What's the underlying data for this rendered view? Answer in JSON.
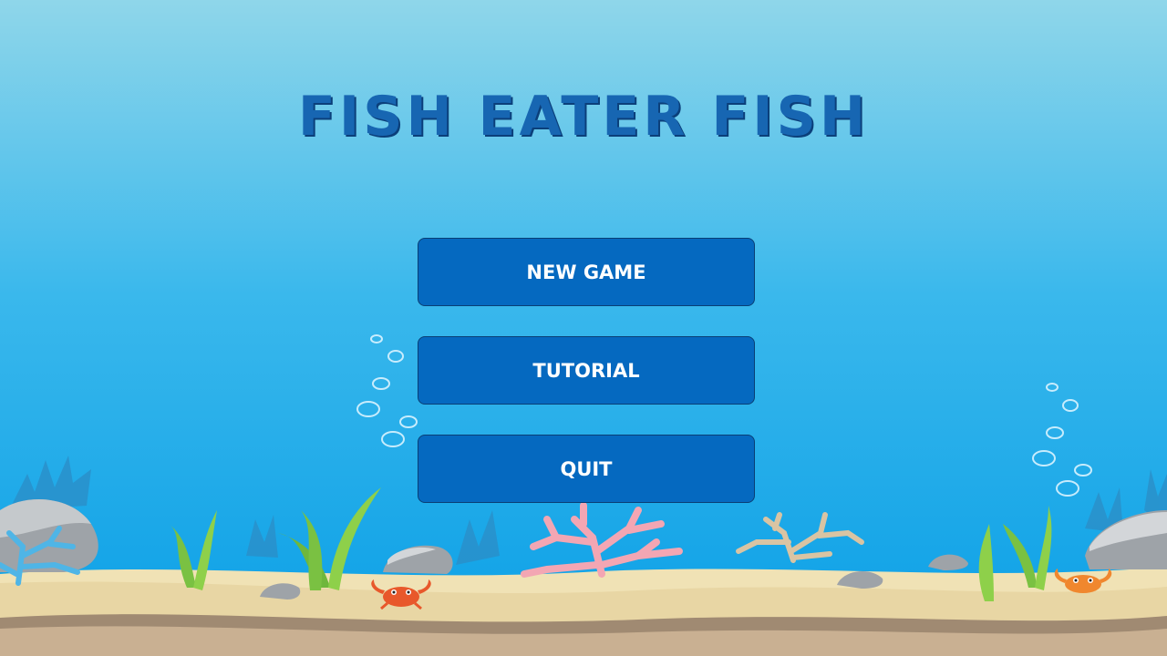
{
  "game": {
    "title": "FISH EATER FISH"
  },
  "menu": {
    "new_game_label": "NEW GAME",
    "tutorial_label": "TUTORIAL",
    "quit_label": "QUIT"
  },
  "scene": {
    "decorations": [
      "bubbles-icon",
      "coral-icon",
      "seaweed-icon",
      "rock-icon",
      "crab-icon",
      "sand-floor"
    ]
  },
  "colors": {
    "sky_top": "#8fd6ea",
    "sky_bottom": "#0a9fe6",
    "title": "#1766b2",
    "button": "#0569c0",
    "button_border": "#0a3f75",
    "sand": "#f0e2b5",
    "ground": "#c9b092"
  }
}
